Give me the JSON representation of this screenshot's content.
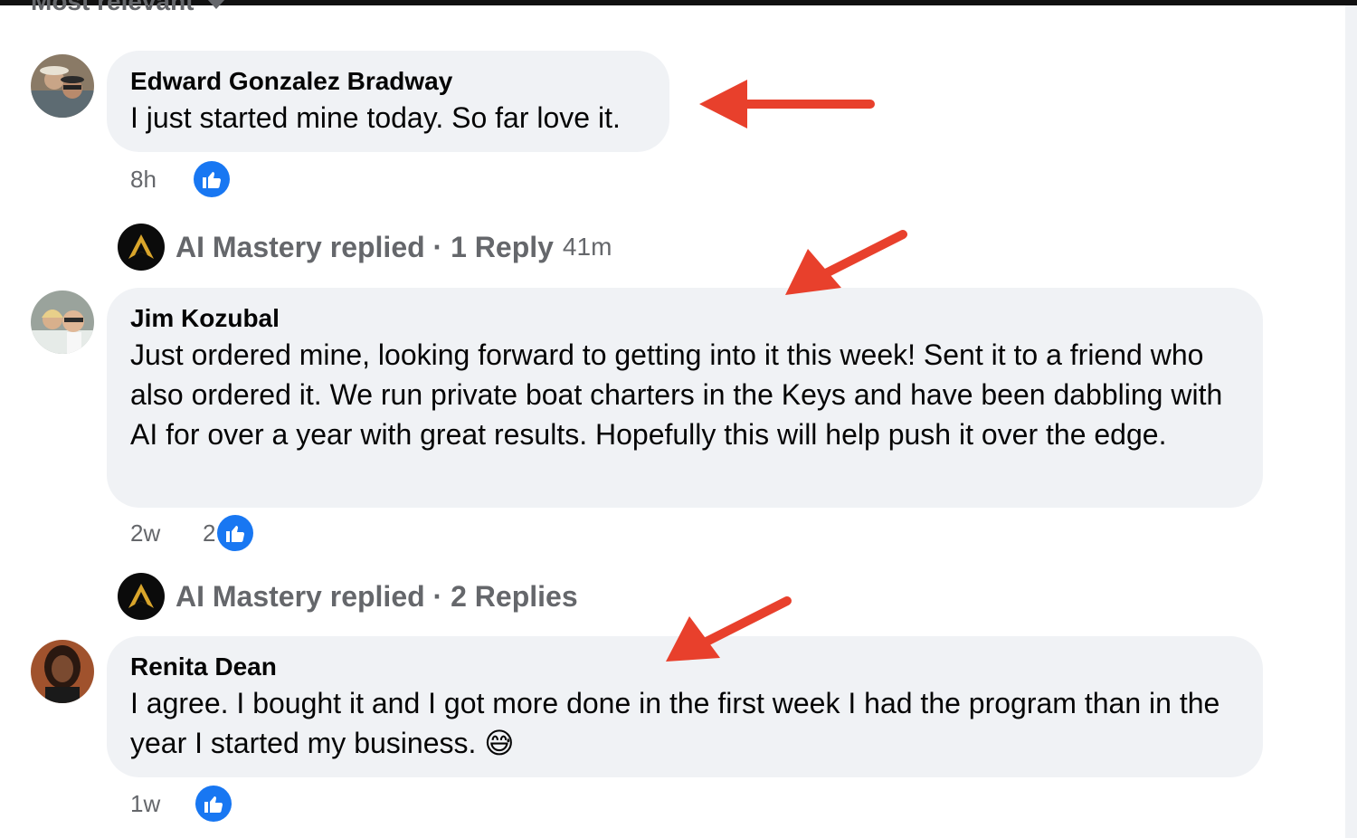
{
  "sort": {
    "label": "Most relevant"
  },
  "comments": [
    {
      "author": "Edward Gonzalez Bradway",
      "text": "I just started mine today. So far love it.",
      "time": "8h",
      "like_count": "",
      "reply_summary": {
        "label": "AI Mastery replied · 1 Reply",
        "time": "41m"
      }
    },
    {
      "author": "Jim Kozubal",
      "text": "Just ordered mine, looking forward to getting into it this week! Sent it to a friend who also ordered it. We run private boat charters in the Keys and have been dabbling with AI for over a year with great results. Hopefully this will help push it over the edge.",
      "time": "2w",
      "like_count": "2",
      "reply_summary": {
        "label": "AI Mastery replied · 2 Replies",
        "time": ""
      }
    },
    {
      "author": "Renita Dean",
      "text": "I agree. I bought it and I got more done in the first week I had the program than in the year I started my business. 😅",
      "time": "1w",
      "like_count": ""
    }
  ],
  "colors": {
    "bubble": "#f0f2f5",
    "like": "#1877f2",
    "arrow": "#e8402c",
    "meta_text": "#65676b"
  },
  "icons": [
    "like-thumb-icon",
    "ai-mastery-logo-icon",
    "dropdown-caret-icon",
    "red-arrow-annotation"
  ]
}
